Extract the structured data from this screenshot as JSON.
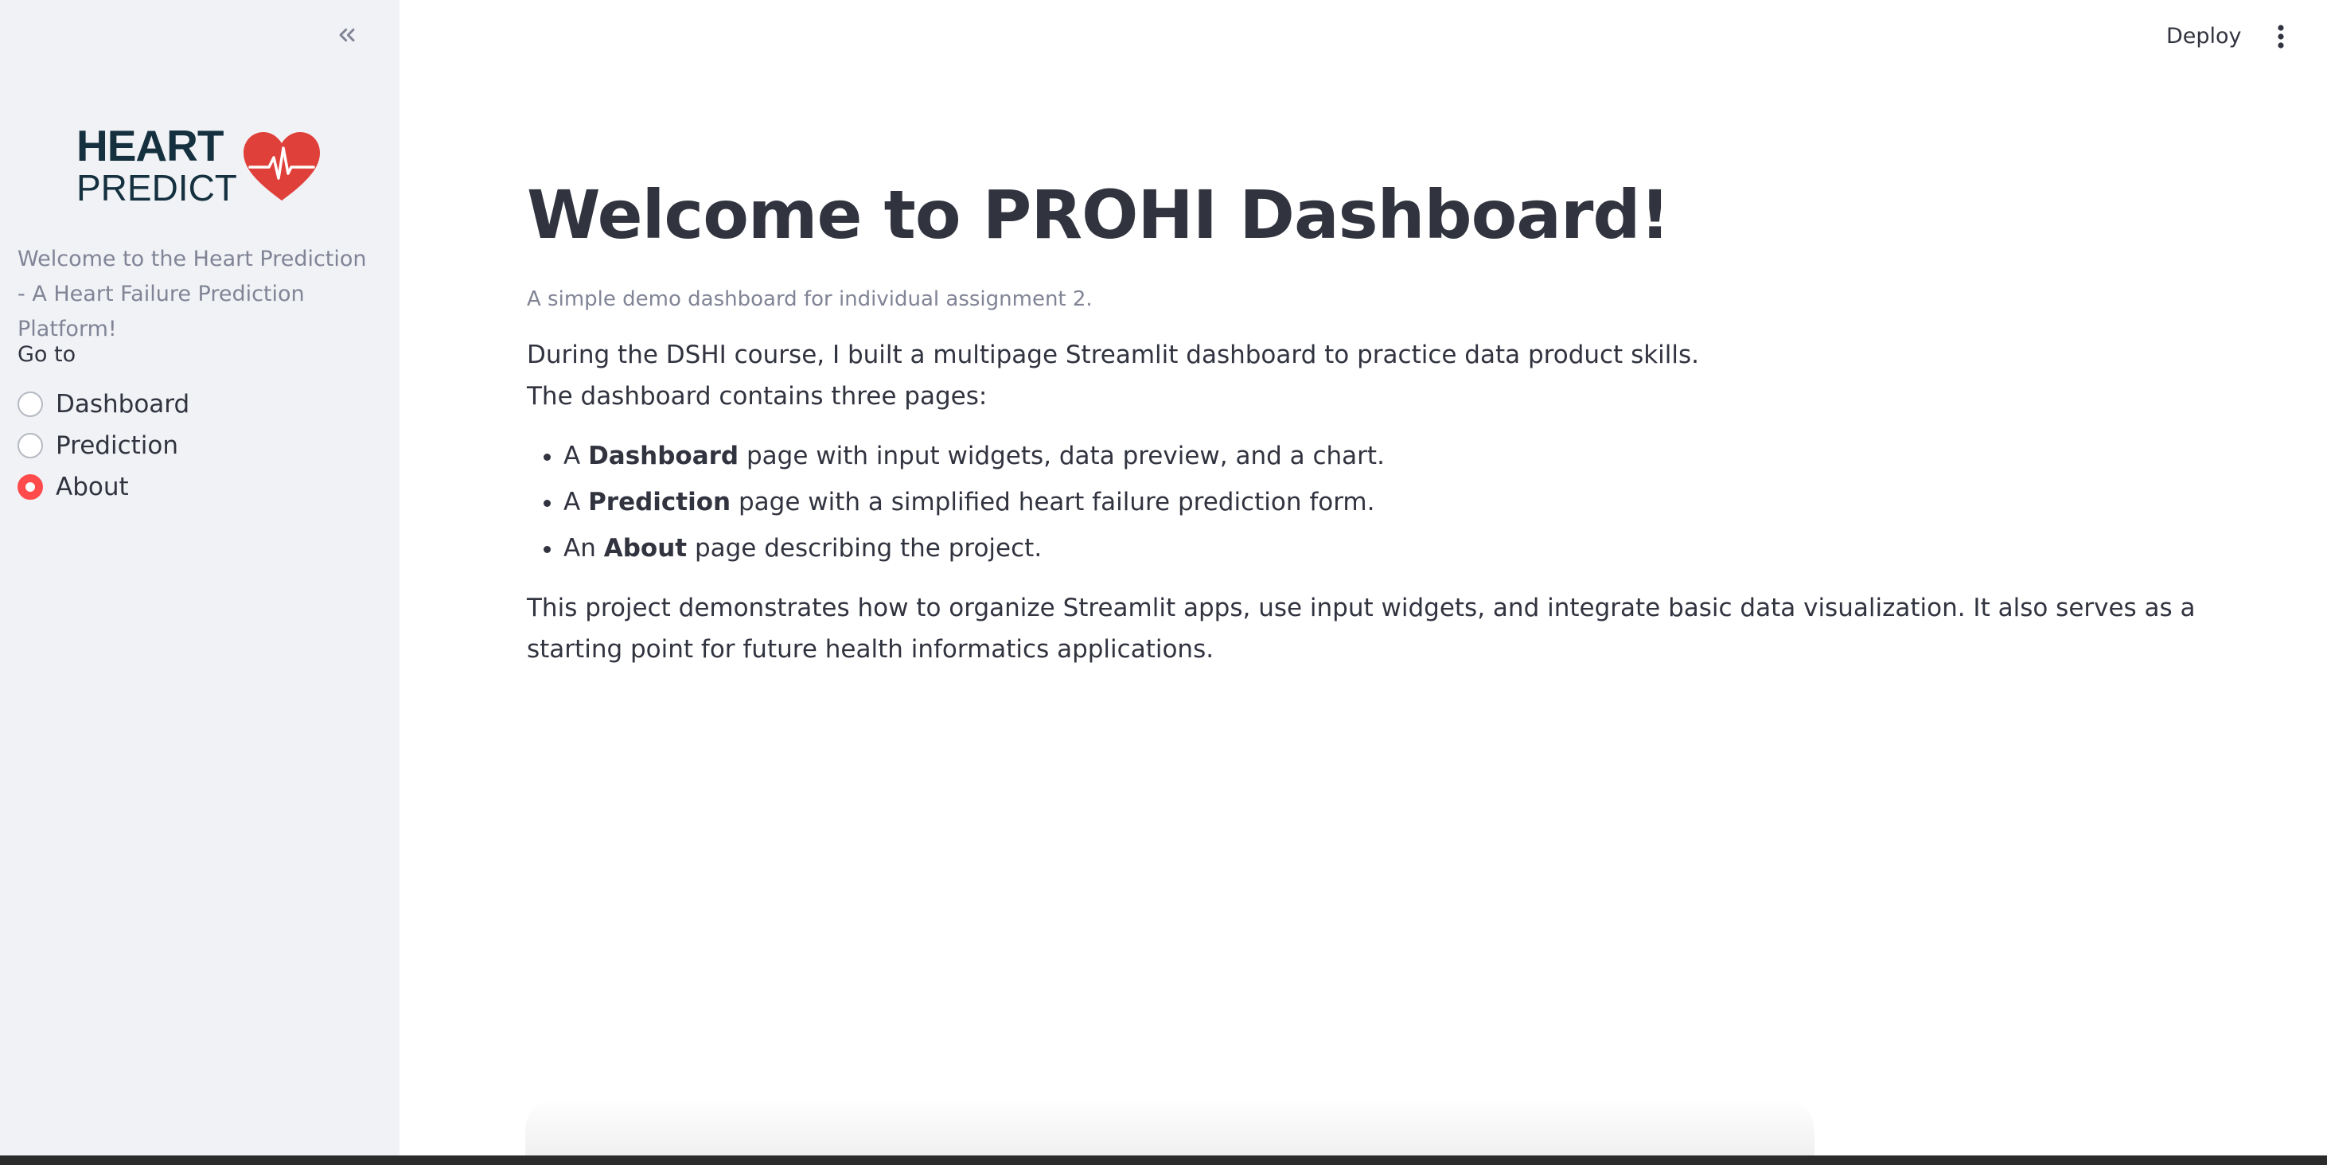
{
  "sidebar": {
    "collapse_icon": "chevrons-left-icon",
    "logo": {
      "line1": "HEART",
      "line2": "PREDICT",
      "icon": "heart-pulse-icon",
      "colors": {
        "text": "#15313f",
        "heart": "#e0403a"
      }
    },
    "intro": "Welcome to the Heart Prediction - A Heart Failure Prediction Platform!",
    "nav_label": "Go to",
    "nav_options": [
      {
        "label": "Dashboard",
        "selected": false
      },
      {
        "label": "Prediction",
        "selected": false
      },
      {
        "label": "About",
        "selected": true
      }
    ]
  },
  "header": {
    "deploy_label": "Deploy",
    "menu_icon": "more-vertical-icon"
  },
  "main": {
    "title": "Welcome to PROHI Dashboard!",
    "caption": "A simple demo dashboard for individual assignment 2.",
    "intro_line1": "During the DSHI course, I built a multipage Streamlit dashboard to practice data product skills.",
    "intro_line2": "The dashboard contains three pages:",
    "pages": [
      {
        "prefix": "A ",
        "name": "Dashboard",
        "suffix": " page with input widgets, data preview, and a chart."
      },
      {
        "prefix": "A ",
        "name": "Prediction",
        "suffix": " page with a simplified heart failure prediction form."
      },
      {
        "prefix": "An ",
        "name": "About",
        "suffix": " page describing the project."
      }
    ],
    "closing": "This project demonstrates how to organize Streamlit apps, use input widgets, and integrate basic data visualization. It also serves as a starting point for future health informatics applications."
  },
  "colors": {
    "accent": "#ff4b4b",
    "sidebar_bg": "#f0f2f6",
    "text": "#31333f",
    "muted": "#808495"
  }
}
